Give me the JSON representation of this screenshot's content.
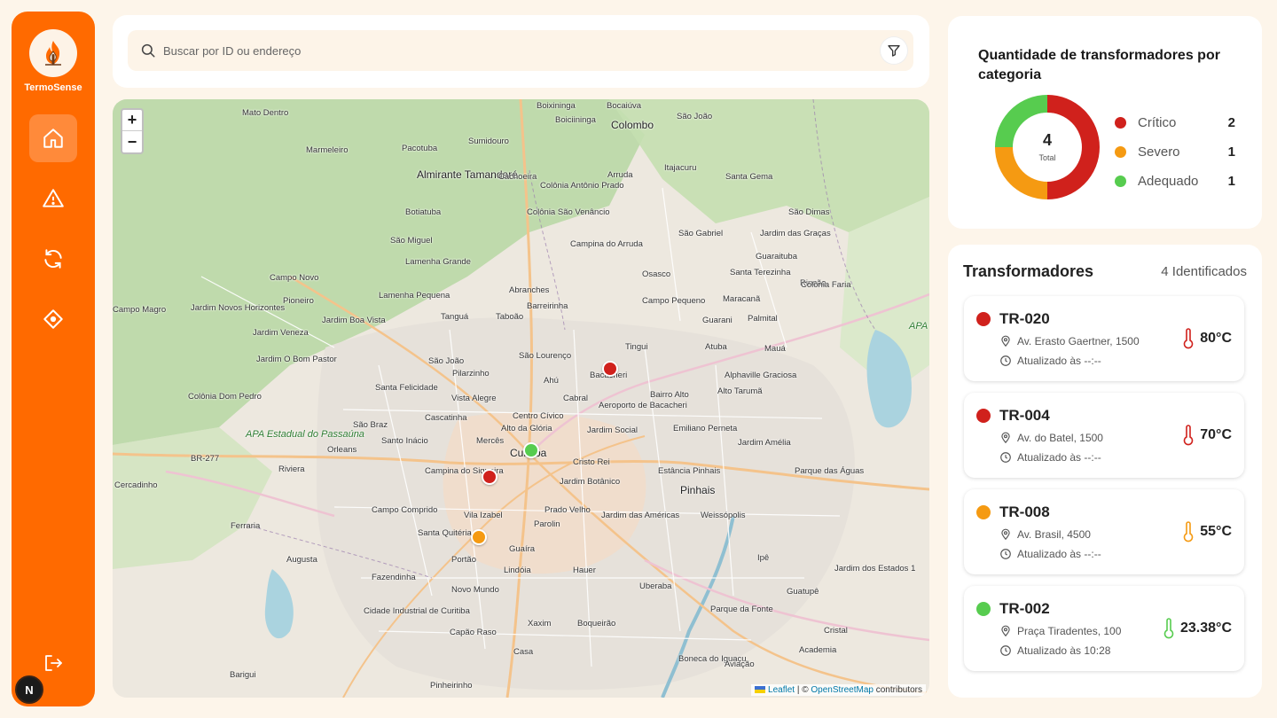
{
  "app": {
    "brand": "TermoSense",
    "avatar_initial": "N"
  },
  "colors": {
    "sidebar": "#ff6a00",
    "critical": "#d0211c",
    "severe": "#f59a12",
    "adequate": "#57cc4f"
  },
  "sidebar": {
    "items": [
      {
        "icon": "home-icon",
        "active": true
      },
      {
        "icon": "alert-triangle-icon",
        "active": false
      },
      {
        "icon": "refresh-icon",
        "active": false
      },
      {
        "icon": "diamond-location-icon",
        "active": false
      }
    ],
    "logout_icon": "logout-icon"
  },
  "search": {
    "placeholder": "Buscar por ID ou endereço"
  },
  "map": {
    "zoom_in": "+",
    "zoom_out": "−",
    "attribution": {
      "leaflet": "Leaflet",
      "sep": " | © ",
      "osm": "OpenStreetMap",
      "suffix": " contributors"
    },
    "labels": [
      "Boixininga",
      "Bocaiúva",
      "Mato Dentro",
      "Boiciininga",
      "São João",
      "Colombo",
      "Sumidouro",
      "Pacotuba",
      "Marmeleiro",
      "Almirante Tamandaré",
      "Cachoeira",
      "Colônia Antônio Prado",
      "Arruda",
      "Itajacuru",
      "Santa Gema",
      "Botiatuba",
      "Colônia São Venâncio",
      "São Dimas",
      "São Gabriel",
      "Jardim das Graças",
      "São Miguel",
      "Campina do Arruda",
      "Guaraituba",
      "Lamenha Grande",
      "Osasco",
      "Santa Terezinha",
      "Rincão",
      "Campo Novo",
      "Abranches",
      "Maracanã",
      "Colônia Faria",
      "Campo Magro",
      "Jardim Novos Horizontes",
      "Pioneiro",
      "Lamenha Pequena",
      "Barreirinha",
      "Campo Pequeno",
      "Guarani",
      "Palmital",
      "Jardim Boa Vista",
      "Tanguá",
      "Taboão",
      "Tingui",
      "Atuba",
      "Mauá",
      "Jardim Veneza",
      "São João",
      "São Lourenço",
      "Bairro Alto",
      "Alphaville Graciosa",
      "Jardim O Bom Pastor",
      "Pilarzinho",
      "Ahú",
      "Bacacheri",
      "Aeroporto de Bacacheri",
      "Colônia Dom Pedro",
      "Santa Felicidade",
      "Vista Alegre",
      "Cabral",
      "Alto Tarumã",
      "Cascatinha",
      "Centro Cívico",
      "São Braz",
      "Alto da Glória",
      "Jardim Social",
      "Emiliano Perneta",
      "APA Estadual do Passaúna",
      "Santo Inácio",
      "Mercês",
      "Jardim Amélia",
      "Orleans",
      "Curitiba",
      "BR-277",
      "Cristo Rei",
      "Estância Pinhais",
      "Parque das Águas",
      "Riviera",
      "Campina do Siqueira",
      "Jardim Botânico",
      "Pinhais",
      "Cercadinho",
      "Campo Comprido",
      "Vila Izabel",
      "Prado Velho",
      "Jardim das Américas",
      "Weissópolis",
      "Ferraria",
      "Santa Quitéria",
      "Parolin",
      "Augusta",
      "Portão",
      "Guaíra",
      "Ipê",
      "Fazendinha",
      "Lindóia",
      "Hauer",
      "Jardim dos Estados 1",
      "Novo Mundo",
      "Uberaba",
      "Guatupê",
      "Cidade Industrial de Curitiba",
      "Xaxim",
      "Boqueirão",
      "Parque da Fonte",
      "Cristal",
      "Capão Raso",
      "Academia",
      "Barigui",
      "Casa",
      "Boneca do Iguaçu",
      "Aviação",
      "Pinheirinho",
      "APA Ir"
    ]
  },
  "summary": {
    "title": "Quantidade de transformadores por categoria",
    "total": 4,
    "total_label": "Total",
    "categories": [
      {
        "label": "Crítico",
        "count": 2,
        "color": "#d0211c"
      },
      {
        "label": "Severo",
        "count": 1,
        "color": "#f59a12"
      },
      {
        "label": "Adequado",
        "count": 1,
        "color": "#57cc4f"
      }
    ]
  },
  "list": {
    "title": "Transformadores",
    "count_label": "4 Identificados",
    "items": [
      {
        "id": "TR-020",
        "address": "Av. Erasto Gaertner, 1500",
        "updated": "Atualizado às --:--",
        "temp": "80°C",
        "color": "#d0211c"
      },
      {
        "id": "TR-004",
        "address": "Av. do Batel, 1500",
        "updated": "Atualizado às --:--",
        "temp": "70°C",
        "color": "#d0211c"
      },
      {
        "id": "TR-008",
        "address": "Av. Brasil, 4500",
        "updated": "Atualizado às --:--",
        "temp": "55°C",
        "color": "#f59a12"
      },
      {
        "id": "TR-002",
        "address": "Praça Tiradentes, 100",
        "updated": "Atualizado às 10:28",
        "temp": "23.38°C",
        "color": "#57cc4f"
      }
    ]
  }
}
